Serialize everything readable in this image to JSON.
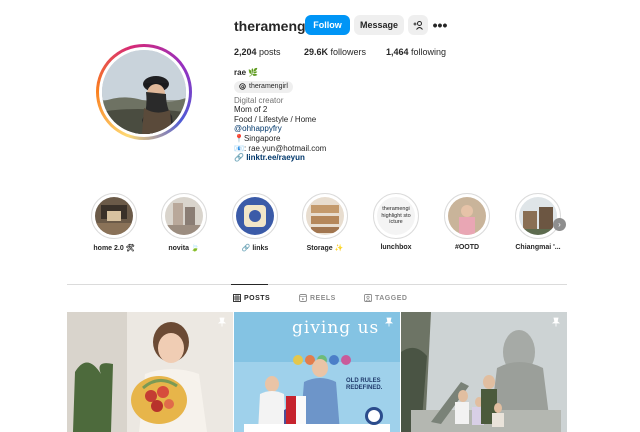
{
  "profile": {
    "username": "theramengirl",
    "follow_label": "Follow",
    "message_label": "Message",
    "add_user_label": "+&",
    "more_label": "•••",
    "stats": {
      "posts": "2,204",
      "posts_label": "posts",
      "followers": "29.6K",
      "followers_label": "followers",
      "following": "1,464",
      "following_label": "following"
    },
    "bio": {
      "name": "rae 🌿",
      "threads_handle": "theramengirl",
      "category": "Digital creator",
      "lines": [
        "Mom of 2",
        "Food / Lifestyle / Home"
      ],
      "mention": "@ohhappyfry",
      "location": "📍Singapore",
      "email": "📧: rae.yun@hotmail.com",
      "link": "linktr.ee/raeyun"
    }
  },
  "highlights": [
    {
      "label": "home 2.0 🛠",
      "icon": "highlight-home"
    },
    {
      "label": "novita 🍃",
      "icon": "highlight-novita"
    },
    {
      "label": "🔗 links",
      "icon": "highlight-links"
    },
    {
      "label": "Storage ✨",
      "icon": "highlight-storage"
    },
    {
      "label": "lunchbox",
      "icon": "highlight-lunchbox",
      "cover_text": "theramengi highlight sto icture"
    },
    {
      "label": "#OOTD",
      "icon": "highlight-ootd"
    },
    {
      "label": "Chiangmai '...",
      "icon": "highlight-chiangmai"
    }
  ],
  "tabs": [
    {
      "label": "POSTS",
      "icon": "grid-icon",
      "active": true
    },
    {
      "label": "REELS",
      "icon": "reels-icon",
      "active": false
    },
    {
      "label": "TAGGED",
      "icon": "tagged-icon",
      "active": false
    }
  ],
  "posts": [
    {
      "pinned": true,
      "icon": "pin-icon"
    },
    {
      "pinned": true,
      "icon": "pin-icon",
      "headline": "giving us",
      "tagline": "OLD RULES REDEFINED."
    },
    {
      "pinned": true,
      "icon": "pin-icon"
    }
  ],
  "colors": {
    "accent": "#0095f6",
    "text": "#262626",
    "muted": "#737373",
    "link": "#00376b",
    "button_bg": "#efefef"
  }
}
